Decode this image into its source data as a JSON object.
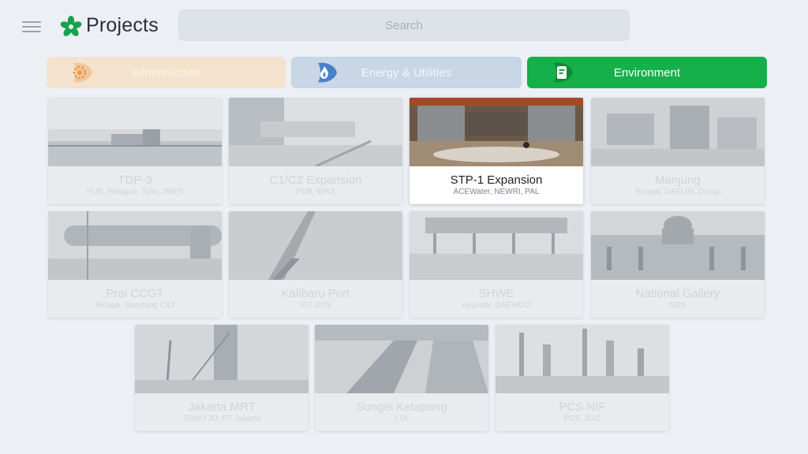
{
  "header": {
    "title": "Projects",
    "search_placeholder": "Search",
    "menu_icon": "hamburger-icon",
    "logo_icon": "flower-logo-icon"
  },
  "tabs": [
    {
      "label": "Infrastructure",
      "icon": "gear-icon",
      "selected": false,
      "color": "#f4e2cc"
    },
    {
      "label": "Energy & Utilities",
      "icon": "flame-icon",
      "selected": false,
      "color": "#c8d6e6"
    },
    {
      "label": "Environment",
      "icon": "leaf-document-icon",
      "selected": true,
      "color": "#15b04a"
    }
  ],
  "projects": [
    {
      "title": "TDP-3",
      "subtitle": "PUB, Tedagua, Tylin, JMPS",
      "active": false
    },
    {
      "title": "C1/C2 Expansion",
      "subtitle": "PUB, WRX",
      "active": false
    },
    {
      "title": "STP-1 Expansion",
      "subtitle": "ACEWater, NEWRI, PAL",
      "active": true
    },
    {
      "title": "Manjung",
      "subtitle": "Tenaga, DAELIM, Donga",
      "active": false
    },
    {
      "title": "Prai CCGT",
      "subtitle": "Tenaga, Samsung C&T",
      "active": false
    },
    {
      "title": "Kalibaru Port",
      "subtitle": "PP, DSS",
      "active": false
    },
    {
      "title": "SHWE",
      "subtitle": "Hyundai, DAEWOO",
      "active": false
    },
    {
      "title": "National Gallery",
      "subtitle": "NGS",
      "active": false
    },
    {
      "title": "Jakarta MRT",
      "subtitle": "SOWJ JO, PT Jakarta",
      "active": false
    },
    {
      "title": "Sungei Ketapang",
      "subtitle": "LTA",
      "active": false
    },
    {
      "title": "PCS NIF",
      "subtitle": "PCS, JGC",
      "active": false
    }
  ],
  "colors": {
    "accent_green": "#15b04a",
    "background": "#ecf0f5"
  }
}
